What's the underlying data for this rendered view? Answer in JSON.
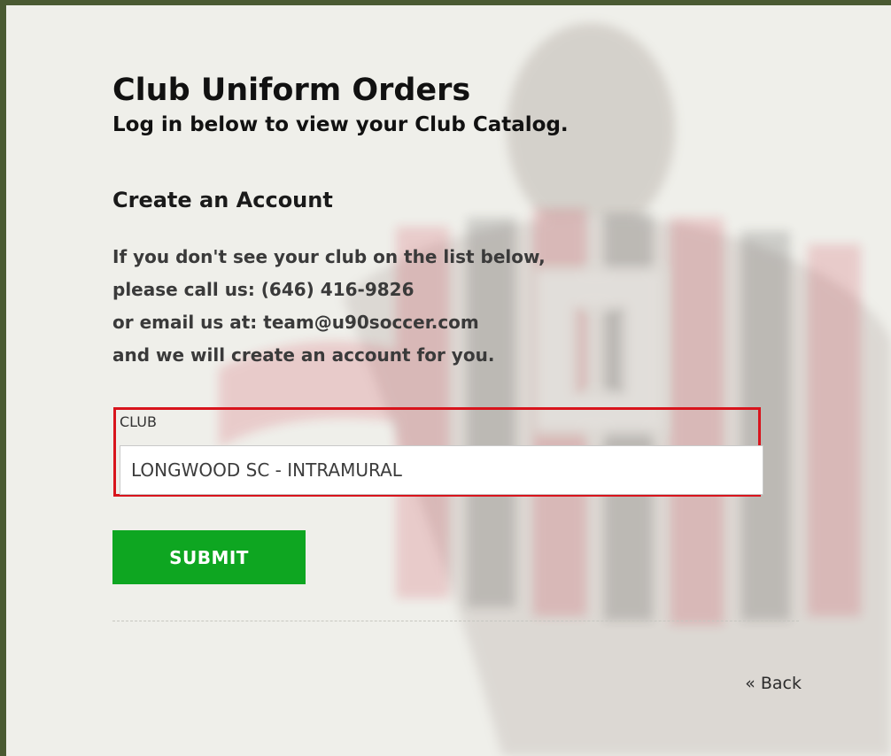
{
  "header": {
    "title": "Club Uniform Orders",
    "subtitle": "Log in below to view your Club Catalog."
  },
  "create_account": {
    "title": "Create an Account",
    "info_lines": [
      "If you don't see your club on the list below,",
      "please call us: (646) 416-9826",
      "or email us at: team@u90soccer.com",
      "and we will create an account for you."
    ]
  },
  "club_field": {
    "label": "CLUB",
    "selected_value": "LONGWOOD SC - INTRAMURAL",
    "highlight_color": "#d8141c"
  },
  "submit": {
    "label": "SUBMIT",
    "color": "#0ea621"
  },
  "back_link": {
    "label": "« Back"
  },
  "colors": {
    "frame_border": "#4a5a32",
    "page_background": "#efefea"
  }
}
